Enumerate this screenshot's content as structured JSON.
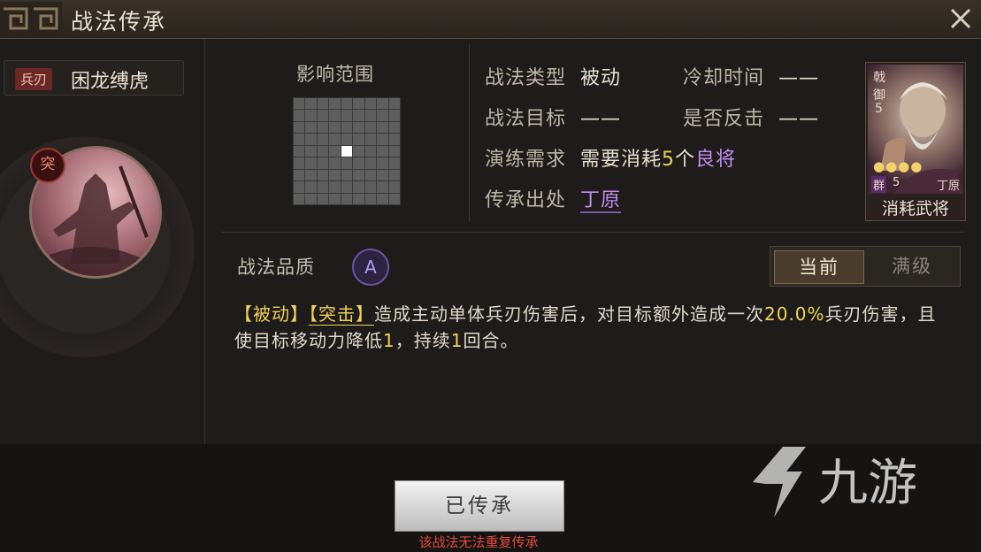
{
  "window": {
    "title": "战法传承"
  },
  "skill": {
    "tag": "兵刃",
    "name": "困龙缚虎",
    "type_badge": "突"
  },
  "range": {
    "label": "影响范围"
  },
  "info": {
    "type_label": "战法类型",
    "type_value": "被动",
    "cooldown_label": "冷却时间",
    "cooldown_value": "——",
    "target_label": "战法目标",
    "target_value": "——",
    "counter_label": "是否反击",
    "counter_value": "——",
    "req_label": "演练需求",
    "req_prefix": "需要消耗",
    "req_count": "5",
    "req_unit": "个",
    "req_grade": "良将",
    "origin_label": "传承出处",
    "origin_value": "丁原"
  },
  "card": {
    "faction_icon": "戟",
    "troop": "御",
    "troop_level": "5",
    "stars": "●●●●",
    "faction": "群",
    "cost": "5",
    "name": "丁原",
    "label": "消耗武将"
  },
  "quality": {
    "label": "战法品质",
    "grade": "A"
  },
  "tabs": {
    "current": "当前",
    "max": "满级"
  },
  "description": {
    "p1": "【被动】",
    "p2": "【突击】",
    "p3": "造成主动单体兵刃伤害后，对目标额外造成一次",
    "p4": "20.0%",
    "p5": "兵刃伤害，且使目标移动力降低",
    "p6": "1",
    "p7": "，持续",
    "p8": "1",
    "p9": "回合。"
  },
  "footer": {
    "button": "已传承",
    "warning": "该战法无法重复传承"
  },
  "watermark": {
    "text": "九游"
  },
  "colors": {
    "gold": "#f2d15a",
    "purple": "#c38bf0",
    "warning": "#e04a3a"
  }
}
